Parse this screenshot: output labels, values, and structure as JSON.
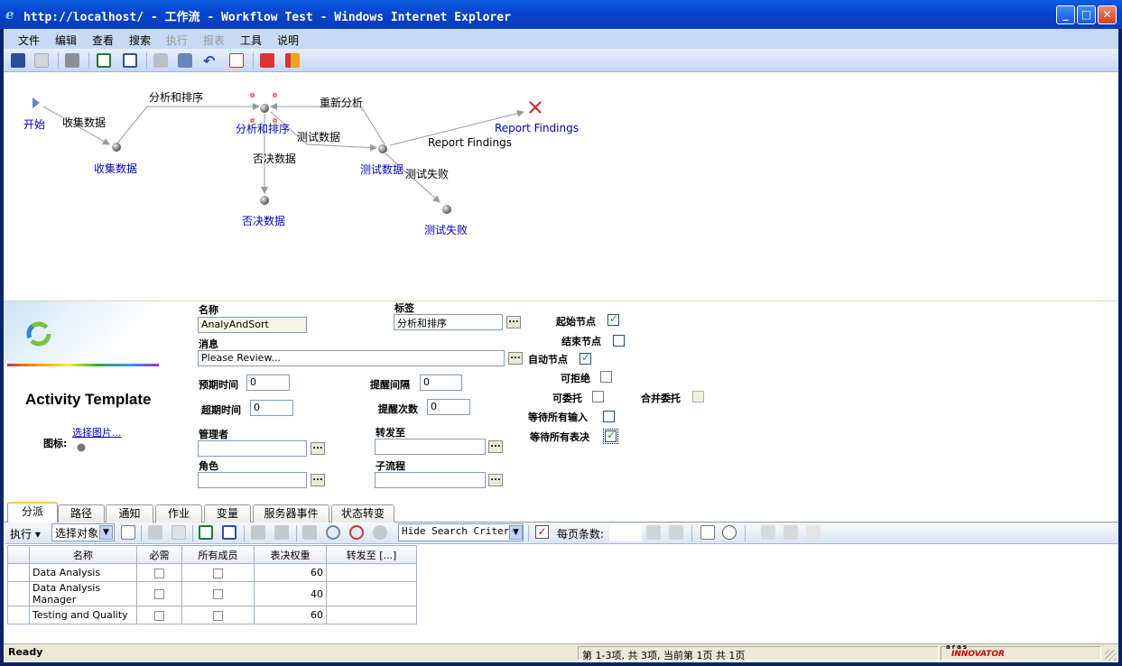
{
  "window": {
    "title": "http://localhost/ - 工作流 - Workflow Test - Windows Internet Explorer",
    "minimize": "_",
    "maximize": "□",
    "close": "✕"
  },
  "menu": [
    "文件",
    "编辑",
    "查看",
    "搜索",
    "执行",
    "报表",
    "工具",
    "说明"
  ],
  "toolbar_icons": [
    "save-icon",
    "close-doc-icon",
    "print-icon",
    "excel-icon",
    "word-icon",
    "lock-icon",
    "unlock-icon",
    "undo-icon",
    "report-icon",
    "exit-icon",
    "logout-icon"
  ],
  "workflow": {
    "nodes": {
      "start": "开始",
      "collect": "收集数据",
      "analyze": "分析和排序",
      "reject": "否决数据",
      "test": "测试数据",
      "fail": "测试失败",
      "report": "Report Findings"
    },
    "paths": {
      "start_collect": "收集数据",
      "collect_analyze": "分析和排序",
      "reanalyze": "重新分析",
      "analyze_test": "测试数据",
      "analyze_reject": "否决数据",
      "test_report": "Report Findings",
      "test_fail": "测试失败"
    }
  },
  "form": {
    "banner_title": "Activity Template",
    "choose_image": "选择图片...",
    "icon_label": "图标:",
    "name_label": "名称",
    "name_value": "AnalyAndSort",
    "tag_label": "标签",
    "tag_value": "分析和排序",
    "message_label": "消息",
    "message_value": "Please Review...",
    "expected_time_label": "预期时间",
    "expected_time_value": "0",
    "remind_interval_label": "提醒间隔",
    "remind_interval_value": "0",
    "timeout_label": "超期时间",
    "timeout_value": "0",
    "remind_count_label": "提醒次数",
    "remind_count_value": "0",
    "manager_label": "管理者",
    "forward_label": "转发至",
    "role_label": "角色",
    "subflow_label": "子流程",
    "dots": "...",
    "flags": {
      "start_node": {
        "label": "起始节点",
        "checked": true
      },
      "end_node": {
        "label": "结束节点",
        "checked": false
      },
      "auto_node": {
        "label": "自动节点",
        "checked": true
      },
      "can_refuse": {
        "label": "可拒绝",
        "checked": false
      },
      "can_delegate": {
        "label": "可委托",
        "checked": false
      },
      "merge_delegate": {
        "label": "合并委托",
        "checked": false
      },
      "wait_all_inputs": {
        "label": "等待所有输入",
        "checked": false
      },
      "wait_all_votes": {
        "label": "等待所有表决",
        "checked": true
      }
    }
  },
  "tabs": [
    "分派",
    "路径",
    "通知",
    "作业",
    "变量",
    "服务器事件",
    "状态转变"
  ],
  "grid_toolbar": {
    "execute": "执行 ▾",
    "select_target": "选择对象",
    "search_mode": "Hide Search Criteria",
    "per_page_label": "每页条数:",
    "per_page_value": ""
  },
  "grid": {
    "columns": [
      "名称",
      "必需",
      "所有成员",
      "表决权重",
      "转发至 [...]"
    ],
    "rows": [
      {
        "name": "Data Analysis",
        "required": false,
        "all_members": false,
        "weight": "60",
        "forward": ""
      },
      {
        "name": "Data Analysis Manager",
        "required": false,
        "all_members": false,
        "weight": "40",
        "forward": ""
      },
      {
        "name": "Testing and Quality",
        "required": false,
        "all_members": false,
        "weight": "60",
        "forward": ""
      }
    ]
  },
  "status": {
    "left": "Ready",
    "paging": "第 1-3项, 共 3项, 当前第 1页 共 1页",
    "brand": "INNOVATOR",
    "brand_small": "aras"
  }
}
